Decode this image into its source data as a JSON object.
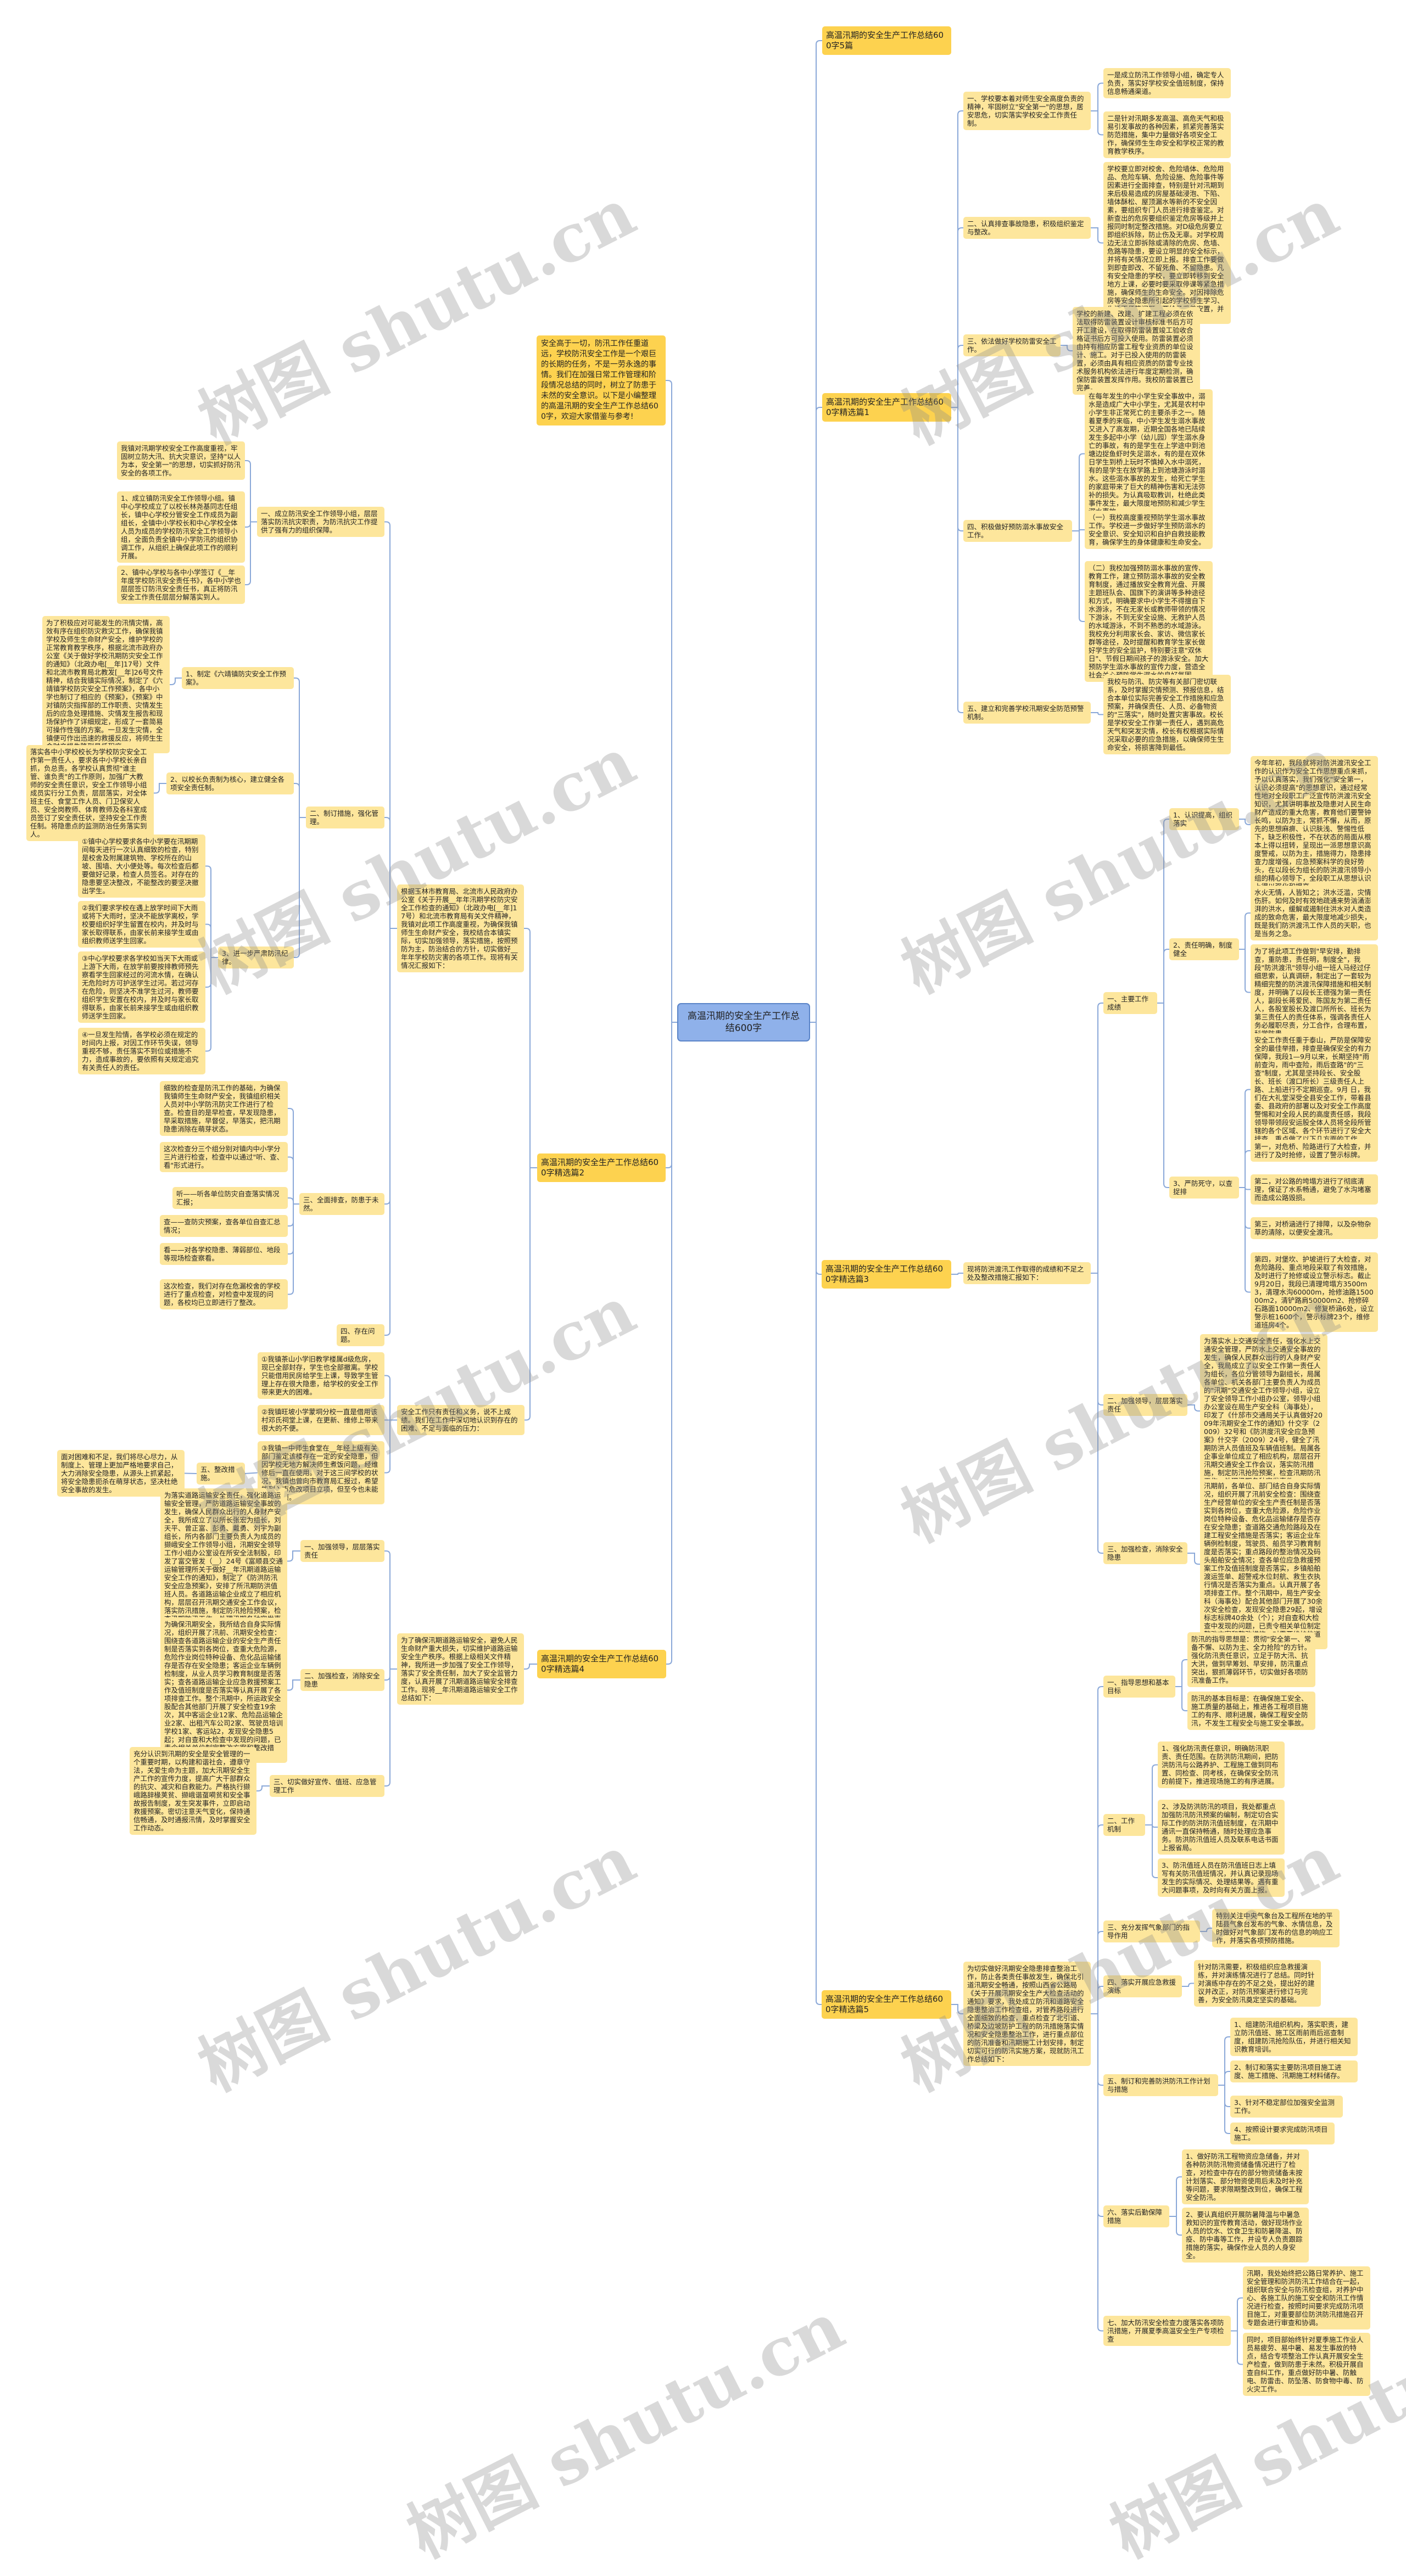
{
  "root": "高温汛期的安全生产工作总结600字",
  "intro": "安全高于一切，防汛工作任重道远，学校防汛安全工作是一个艰巨的长期的任务，不是一劳永逸的事情。我们在加强日常工作管理和阶段情况总结的同时，树立了防患于未然的安全意识。以下是小编整理的高温汛期的安全生产工作总结600字，欢迎大家借鉴与参考!",
  "watermark": "树图 shutu.cn",
  "colors": {
    "root_fill": "#8fb1ea",
    "root_border": "#5a84c8",
    "branch_fill": "#fdd24f",
    "node_fill": "#fde69c",
    "connector": "#8aa8d8"
  },
  "b0": {
    "title": "高温汛期的安全生产工作总结600字5篇"
  },
  "b1": {
    "title": "高温汛期的安全生产工作总结600字精选篇1",
    "items": [
      {
        "label": "一、学校要本着对师生安全高度负责的精神，牢固树立\"安全第一\"的思想，居安思危，切实落实学校安全工作责任制。",
        "details": [
          "一是成立防汛工作领导小组，确定专人负责，落实好学校安全值班制度，保持信息畅通渠道。",
          "二是针对汛期多发高温、高危天气和极易引发事故的各种因素，抓紧完善落实防范措施，集中力量做好各项安全工作，确保师生生命安全和学校正常的教育教学秩序。"
        ]
      },
      {
        "label": "二、认真排查事故隐患，积极组织鉴定与整改。",
        "details": [
          "学校要立即对校舍、危险墙体、危险用品、危险车辆、危险设施、危险事件等因素进行全面排查，特别是针对汛期到来后极易造成的房屋基础浸泡、下陷、墙体酥松、屋顶漏水等新的不安全因素，要组织专门人员进行排查鉴定。对新查出的危房要组织鉴定危房等级并上报同时制定整改措施。对D级危房要立即组织拆除，防止伤及无辜。对学校周边无法立即拆除或清除的危房、危墙、危路等隐患，要设立明显的安全标示，并将有关情况立即上报。排查工作要做到即查即改、不留死角、不留隐患。凡有安全隐患的学校，要立即转移到安全地方上课，必要时要采取停课等紧急措施，确保师生的生命安全。对因排除危房等安全隐患所引起的学校师生学习、生活不便等问题，要给予妥善安置，并及时将详细情况上报镇教委。"
        ]
      },
      {
        "label": "三、依法做好学校防雷安全工作。",
        "details": [
          "学校的新建、改建、扩建工程必须在依法取得防雷装置设计审核标准书后方可开工建设，在取得防雷装置竣工验收合格证书后方可投入使用。防雷装置必须由持有相应防雷工程专业资质的单位设计、施工。对于已投入使用的防雷装置，必须由具有相应资质的防雷专业技术服务机构依法进行年度定期检测，确保防雷装置发挥作用。我校防雷装置已完善。"
        ]
      },
      {
        "label": "四、积极做好预防溺水事故安全工作。",
        "details": [
          "在每年发生的中小学生安全事故中，溺水是造成广大中小学生，尤其是农村中小学生非正常死亡的主要杀手之一。随着夏季的来临，中小学生发生溺水事故又进入了高发期，近期全国各地已陆续发生多起中小学（幼儿园）学生溺水身亡的事故，有的是学生在上学途中到池塘边捉鱼虾时失足溺水，有的是在双休日学生到桥上玩时不慎掉入水中溺死，有的是学生在放学路上到池塘游泳时溺水。这些溺水事故的发生，给死亡学生的家庭带来了巨大的精神伤害和无法弥补的损失。为认真吸取教训，杜绝此类事件发生，最大限度地预防和减少学生溺水事故。",
          "（一）我校高度重视预防学生溺水事故工作。学校进一步做好学生预防溺水的安全意识、安全知识和自护自救技能教育，确保学生的身体健康和生命安全。",
          "（二）我校加强预防溺水事故的宣传、教育工作，建立预防溺水事故的安全教育制度，通过播放安全教育光盘、开展主题班队会、国旗下的演讲等多种途径和方式，明确要求中小学生不得擅自下水游泳，不在无家长或教师带领的情况下游泳，不到无安全设施、无救护人员的水域游泳，不到不熟悉的水域游泳。我校充分利用家长会、家访、微信家长群等途径，及时提醒和教育学生家长做好学生的安全监护，特别要注意\"双休日\"、节假日期间孩子的游泳安全。加大预防学生溺水事故的宣传力度，营造全社会关心预防学生溺水的良好氛围。"
        ]
      },
      {
        "label": "五、建立和完善学校汛期安全防范预警机制。",
        "details": [
          "我校与防汛、防灾等有关部门密切联系，及时掌握灾情预测、预报信息，结合本单位实际完善安全工作措施和应急预案，并确保责任、人员、必备物资的\"三落实\"，随时处置灾害事故。校长是学校安全工作第一责任人，遇到高危天气和突发灾情，校长有权根据实际情况采取必要的应急措施，以确保师生生命安全，将损害降到最低。"
        ]
      }
    ]
  },
  "b2": {
    "title": "高温汛期的安全生产工作总结600字精选篇2",
    "intro": "根据玉林市教育局、北流市人民政府办公室《关于开展__年年汛期学校防灾安全工作检查的通知》（北政办电[__年]17号）和北流市教育局有关文件精神，我镇对此项工作高度重视，为确保我镇师生生命财产安全，我校结合本镇实际，切实加强领导，落实措施，按照预防为主，防治结合的方针，切实做好__年年学校防灾害的各项工作。现将有关情况汇报如下：",
    "s1": {
      "label": "一、成立防汛安全工作领导小组，层层落实防汛抗灾职责，为防汛抗灾工作提供了强有力的组织保障。",
      "details": [
        "我镇对汛期学校安全工作高度重视，牢固树立防大汛、抗大灾意识，坚持\"以人为本，安全第一\"的思想，切实抓好防汛安全的各项工作。",
        "1、成立镇防汛安全工作领导小组。镇中心学校成立了以校长林尧基同志任组长，镇中心学校分管安全工作成员为副组长，全镇中小学校长和中心学校全体人员为成员的学校防汛安全工作领导小组，全面负责全镇中小学防汛的组织协调工作，从组织上确保此项工作的顺利开展。",
        "2、镇中心学校与各中小学签订《__年年度学校防汛安全责任书》，各中小学也层层签订防汛安全责任书，真正将防汛安全工作责任层层分解落实到人。"
      ]
    },
    "s2": {
      "label": "二、制订措施，强化管理。",
      "g1": {
        "label": "1、制定《六靖镇防灾安全工作预案》。",
        "detail": "为了积极应对可能发生的汛情灾情，高效有序在组织防灾救灾工作，确保我镇学校及师生生命财产安全，维护学校的正常教育教学秩序，根据北流市政府办公室《关于做好学校汛期防灾安全工作的通知》（北政办电[__年]17号）文件和北流市教育局北教发[__年]26号文件精神，结合我镇实际情况，制定了《六靖镇学校防灾安全工作预案》，各中小学也制订了相应的《预案》，《预案》中对镇防灾指挥部的工作职责、灾情发生后的应急处理措施、灾情发生报告和现场保护作了详细规定，形成了一套简易可操作性强的方案。一旦发生灾情，全镇便可作出迅速的救援反应，将师生生命财产损失降到最低程度。"
      },
      "g2": {
        "label": "2、以校长负责制为核心，建立健全各项安全责任制。",
        "detail": "落实各中小学校校长为学校防灾安全工作第一责任人，要求各中小学校长亲自抓，负总责。各学校认真贯彻\"谁主管、谁负责\"的工作原则，加强广大教师的安全责任意识，安全工作领导小组成员实行分工负责，层层落实，对全体班主任、食堂工作人员、门卫保安人员、安全岗教师、体育教师及各科室成员签订了安全责任状，坚持安全工作责任制。将隐患点的监测防治任务落实到人。"
      },
      "g3": {
        "label": "3、进一步严肃防汛纪律。",
        "details": [
          "①镇中心学校要求各中小学要在汛期期间每天进行一次认真细致的检查，特别是校舍及附属建筑物、学校所在的山坡、围墙、大小便处等。每次检查后都要做好记录，检查人员签名。对存在的隐患要坚决整改，不能整改的要坚决撤出学生。",
          "②我们要求学校在遇上放学时间下大雨或将下大雨时，坚决不能放学离校，学校要组织好学生留置在校内，并及时与家长取得联系，由家长前来接学生或由组织教师送学生回家。",
          "③中心学校要求各学校如当天下大雨或上游下大雨，在放学前要按排教师预先察看学生回家经过的河流水情，在确认无危险时方可护送学生过河。若过河存在危险，则坚决不准学生过河，教师要组织学生安置在校内，并及时与家长取得联系，由家长前来接学生或由组织教师送学生回家。",
          "④一旦发生险情，各学校必须在规定的时间内上报，对因工作环节失误，领导重视不够，责任落实不到位或措施不力，造成事故的，要依照有关规定追究有关责任人的责任。"
        ]
      }
    },
    "s3": {
      "label": "三、全面排查，防患于未然。",
      "details": [
        "细致的检查是防汛工作的基础，为确保我镇师生生命财产安全，我镇组织相关人员对中小学防汛防灾工作进行了检查。检查目的是早检查，早发现隐患，早采取措施，早督促，早落实，把汛期隐患消除在萌芽状态。",
        "这次检查分三个组分别对镇内中小学分三片进行检查，检查中以通过\"听、查、看\"形式进行。",
        "听——听各单位防灾自查落实情况汇报；",
        "查——查防灾预案，查各单位自查汇总情况；",
        "看——对各学校隐患、薄弱部位、地段等现场检查察看。",
        "这次检查，我们对存在危漏校舍的学校进行了重点检查，对检查中发现的问题，各校均已立即进行了整改。"
      ]
    },
    "s4": {
      "label": "四、存在问题。"
    },
    "safety": {
      "label": "安全工作只有责任和义务，说不上成绩。我们在工作中深切地认识到存在的困难、不足与面临的压力：",
      "details": [
        "①我镇茶山小学旧教学楼属d级危房，现已全部封存，学生也全部撤离。学校只能借用民房给学生上课，导致学生管理上存在很大隐患，给学校的安全工作带来更大的困难。",
        "②我镇旺坡小学蒙垌分校一直是借用该村邓氏祠堂上课，在更新、维修上带来很大的不便。",
        "③我镇一中师生食堂在__年经上级有关部门鉴定该楼存在一定的安全隐患，但因学校无地方解决师生煮饭问题，经维修后一直在使用。对于这三间学校的状况，我镇也曾向市教育局汇报过，希望能列入市危改项目立项，但至今也未能得到立项。"
      ],
      "s5": {
        "label": "五、整改措施。",
        "detail": "面对困难和不足，我们将尽心尽力，从制度上、管理上更加严格地要求自己，大力消除安全隐患，从源头上抓紧起，将安全隐患扼杀在萌芽状态，坚决杜绝安全事故的发生。"
      }
    }
  },
  "b3": {
    "title": "高温汛期的安全生产工作总结600字精选篇3",
    "intro": "现将防洪渡汛工作取得的成绩和不足之处及整改措施汇报如下：",
    "s1": {
      "label": "一、主要工作成绩",
      "g1": {
        "label": "1、认识提高，组织落实",
        "details": [
          "今年年初，我段就将对防洪渡汛安全工作的认识作为安全工作思想重点来抓，予以认真落实，我们强化\"安全第一，认识必须提高\"的思想意识，通过经常性地对全段职工广泛宣传防洪渡汛安全知识，尤其讲明事故及隐患对人民生命财产造成的重大危害，教育他们要警钟长鸣，以防为主，常抓不懈，从而，原先的思想麻痹、认识肤浅、警惕性低下，缺乏积极性，不在状态的局面从根本上得以扭转，呈现出一派思想意识高度警戒，以防为主，措施得力，隐患排查力度增强，应急预案科学的良好势头，在以段长为组长的防洪渡汛领导小组的精心领导下，全段职工从思想认识上得以强化和提高。"
        ]
      },
      "g2": {
        "label": "2、责任明确，制度健全",
        "details": [
          "水火无情，人皆知之；洪水泛滥，灾情伤肝。如何及时有效地疏通来势汹涌澎湃的洪水，缓解或遏制住洪水对人类造成的致命危害，最大限度地减少损失，既是我们防洪渡汛工作人员的天职，也是当务之急。",
          "为了将此项工作做到\"早安排，勤排查，重防患，责任明，制度全\"，我段\"防洪渡汛\"领导小组一班人马经过仔细思索，认真调研，制定出了一套较为精细完整的防洪渡汛保障措施和相关制度，并明确了以段长王德强为第一责任人，副段长蒋爱民、陈国友为第二责任人，各股室股长及渡口所所长、班长为第三责任人的责任体系，强调各责任人务必履职尽责，分工合作，合理布置，科学防患。"
        ]
      },
      "g3": {
        "label": "3、严防死守，以查捉排",
        "details": [
          "安全工作责任重于泰山，严防是保障安全的最佳举措，排查是确保安全的有力保障，我段1—9月以来，长期坚持\"雨前查沟，雨中查险，雨后查路\"的\"三查\"制度，尤其是坚持段长、安全股长、班长（渡口所长）三级责任人上路、上船进行不定期巡查。9月 日，我们在大礼堂深受全县安全工作，带着县委、县政府的部署以及对安全工作高度警惕和对全段人民的高度责任感，我段领导带领段安运股全体人员将全段所管辖的各个区域、各个环节进行了安全大排查，重点做了以下几方面的工作。",
          "第一，对危桥、险路进行了大检查，并进行了及时抢修，设置了警示标牌。",
          "第二，对公路的垮塌方进行了彻底清理，保证了水系畅通，避免了水沟堵塞而造成公路毁损。",
          "第三，对桥涵进行了排障，以及杂物杂草的清除，以便安全渡汛。",
          "第四，对堡坎、护坡进行了大检查，对危险路段、重点地段采取了有效措施，及时进行了抢修或设立警示标志。截止9月20日，我段已清理垮塌方3500m3，清理水沟60000m，抢修油路150000m2，清铲路肩50000m2、抢修碎石路面10000m2、修复桥涵6处，设立警示桩1600个，警示标牌23个，维修道班房4个。"
        ]
      }
    },
    "s2": {
      "label": "二、加强领导，层层落实责任",
      "detail": "为落实水上交通安全责任，强化水上交通安全管理，严防水上交通安全事故的发生，确保人民群众出行的人身财产安全，我局成立了以安全工作第一责任人为组长，各位分管领导为副组长，局属各单位、机关各部门主要负责人为成员的\"汛期\"交通安全工作领导小组，设立了安全领导工作小组办公室，领导小组办公室设在局生产安全科（海事处），印发了《什邡市交通局关于认真做好2009年汛期安全工作的通知》什交字（2009）32号和《防洪度汛安全应急预案》什交字（2009）24号，健全了汛期防洪人员值班及车辆值班制。局属各企事业单位成立了相应机构，层层召开汛期交通安全工作会议，落实防汛措施，制定防汛抢险预案，检查汛期防汛工作，处理汛期各种突发事件。"
    },
    "s3": {
      "label": "三、加强检查，消除安全隐患",
      "detail": "汛期前，各单位、部门结合自身实际情况，组织开展了汛前安全检查：围绕查生产经营单位的安全生产责任制是否落实到各岗位，查重大危险源，危险作业岗位特种设备、危化品运输储存是否存在安全隐患；查道路交通危险路段及在建工程安全措施是否落实；客运企业车辆例检制度，驾驶员、船员学习教育制度是否落实；重点路段的整治情况及码头船舶安全情况；查各单位应急救援预案工作及值班制度是否落实，乡镇船舶渡运签单、超警戒水位封航、救生衣执行情况是否落实为重点。认真开展了各项排查工作。整个汛期中，局生产安全科（海事处）配合其他部门开展了30余次安全检查，发现安全隐患29起，增设标志标牌40余处（个）；对自查和大检查中发现的问题，已责令相关单位制定整改方案和整改措施，对需要维护的道路安全隐患已报市相关部门。"
    }
  },
  "b4": {
    "title": "高温汛期的安全生产工作总结600字精选篇4",
    "intro": "为了确保汛期道路运输安全，避免人民生命财产重大损失，切实维护道路运输安全生产秩序。根据上级相关文件精神，我所进一步加强了安全工作领导，落实了安全责任制，加大了安全监管力度，认真开展了汛期道路运输安全排查工作。现将__年汛期道路运输安全工作总结如下：",
    "items": [
      {
        "label": "一、加强领导，层层落实责任",
        "detail": "为落实道路运输安全责任，强化道路运输安全管理，严防道路运输安全事故的发生，确保人民群众出行的人身财产安全，我所成立了以所长张宏为组长，刘天平、曾正富、彭勇、戴勇、刘宇为副组长，所内各部门主要负责人为成员的撷峨安全工作领导小组，汛期安全领导工作小组办公室设在所安全法制股，印发了富交管发（__）24号《富顺县交通运输管理所关于做好__年汛期道路运输安全工作的通知》，制定了《防洪防汛安全应急预案》，安排了所汛期防洪值班人员。各道路运输企业成立了相应机构，层层召开汛期交通安全工作会议，落实防汛措施，制定防汛抢险预案，检查汛期防汛工作，处理汛期各种突发事件。"
      },
      {
        "label": "二、加强检查，消除安全隐患",
        "detail": "为确保汛期安全，我所结合自身实际情况，组织开展了汛前、汛期安全检查：围绕查各道路运输企业的安全生产责任制是否落实到各岗位，查重大危险源，危险作业岗位特种设备、危化品运输储存是否存在安全隐患；客运企业车辆例检制度，从业人员学习教育制度是否落实；查各道路运输企业应急救援预案工作及值班制度是否落实等认真开展了各项排查工作。整个汛期中，所运政安全股配合其他部门开展了安全检查19余次，其中客运企业12家、危险品运输企业2家、出租汽车公司2家、驾驶员培训学校1家、客运站2，发现安全隐患5起；对自查和大检查中发现的问题，已责令相关单位制定整改方案和整改措施，并及时整改。"
      },
      {
        "label": "三、切实做好宣传、值班、应急管理工作",
        "detail": "充分认识到汛期的安全是安全管理的一个重要时期，以构建和谐社会，遵章守法，关爱生命为主题，加大汛期安全生产工作的宣传力度，提高广大干部群众的抗灾、减灾和自救能力。严格执行撷峨路辞椽荚贫、撷峨谐虿嗬贫和安全事故报告制度，发生突发事件，立即启动救援预案。密切注意天气变化，保持通信畅通，及时通报汛情，及时掌握安全工作动态。"
      }
    ]
  },
  "b5": {
    "title": "高温汛期的安全生产工作总结600字精选篇5",
    "intro": "为切实做好汛期安全隐患排查整治工作，防止各类责任事故发生，确保北引道汛期安全畅通，按照山西省公路局《关于开展汛期安全生产大检查活动的通知》要求，我处成立防汛和道路安全隐患整治工作检查组，对管养路段进行全面细致的检查，重点检查了北引道、桥梁及边坡防护工程的防汛措施落实情况和安全隐患整治工作，进行重点部位的防汛准备和汛期施工计划安排，制定切实可行的防汛实施方案，现就防汛工作总结如下：",
    "items": [
      {
        "label": "一、指导思想和基本目标",
        "details": [
          "防汛的指导思想是：贯彻\"安全第一、常备不懈、以防为主、全力抢险\"的方针。强化防汛责任意识，立足于防大汛、抗大洪，做到早筹划、早安排，防汛重点突出，狠抓薄弱环节，切实做好各项防汛准备工作。",
          "防汛的基本目标是：在确保施工安全、施工质量的基础上，推进各工程项目施工的有序、顺利进展，确保工程安全防汛，不发生工程安全与施工安全事故。"
        ]
      },
      {
        "label": "二、工作机制",
        "details": [
          "1、强化防汛责任意识，明确防汛职责、责任范围。在防洪防汛期间，把防洪防汛与公路养护、工程施工做到同布置、同检查、同考核，在确保安全防汛的前提下，推进现场施工的有序进展。",
          "2、涉及防洪防汛的项目，我处都重点加强防汛防汛预案的编制，制定切合实际工作的防洪防汛值班制度，在汛期中通讯一直保持畅通，随时处理应急事务。防洪防汛值班人员及联系电话书面上报省局。",
          "3、防汛值班人员在防汛值班日志上填写有关防汛值班情况，并认真记录现场发生的实际情况、处理结果等。遇有重大问题事项，及时向有关方面上报。"
        ]
      },
      {
        "label": "三、充分发挥气象部门的指导作用",
        "details": [
          "特别关注中央气象台及工程所在地的平陆县气象台发布的气象、水情信息，及时做好对气象部门发布的信息的响应工作，并落实各项预防措施。"
        ]
      },
      {
        "label": "四、落实开展应急救援演练",
        "details": [
          "针对防汛需要，积极组织应急救援演练，并对演练情况进行了总结。同时针对演练中存在的不足之处，提出好的建议并改正，对防汛预案进行修订与完善，为安全防汛奠定坚实的基础。"
        ]
      },
      {
        "label": "五、制订和完善防洪防汛工作计划与措施",
        "details": [
          "1、组建防汛组织机构，落实职责，建立防汛值班、施工区雨前雨后巡查制度，组建防汛抢险队伍，并进行相关知识教育培训。",
          "2、制订和落实主要防汛项目施工进度、施工措施、汛期施工材料储存。",
          "3、针对不稳定部位加强安全监测工作。",
          "4、按照设计要求完成防汛项目施工。"
        ]
      },
      {
        "label": "六、落实后勤保障措施",
        "details": [
          "1、做好防汛工程物资应急储备，并对各种防洪防汛物资储备情况进行了检查，对检查中存在的部分物资储备未按计划落实、部分物资使用后未及时补充等问题，要求限期整改到位，确保工程安全防汛。",
          "2、要认真组织开展防暑降温与中暑急救知识的宣传教育活动，做好现场作业人员的饮水、饮食卫生和防暑降温、防疫、防中毒等工作，并设专人负责跟踪措施的落实，确保作业人员的人身安全。"
        ]
      },
      {
        "label": "七、加大防汛安全检查力度落实各项防汛措施，开展夏季高温安全生产专项检查",
        "details": [
          "汛期，我处始终把公路日常养护、施工安全管理和防洪防汛工作结合在一起，组织联合安全与防汛检查组，对养护中心、各施工队的施工安全和防汛工作情况进行检查，按照时间要求完成防汛项目施工，对重要部位防洪防汛措施召开专题会进行审查和协调。",
          "同时，项目部始终针对夏季施工作业人员易疲劳、易中暑、易发生事故的特点，结合专项整治工作认真开展安全生产检查，做到防患于未然。积极开展自查自纠工作，重点做好防中暑、防触电、防雷击、防坠落、防食物中毒、防火灾工作。"
        ]
      }
    ]
  }
}
